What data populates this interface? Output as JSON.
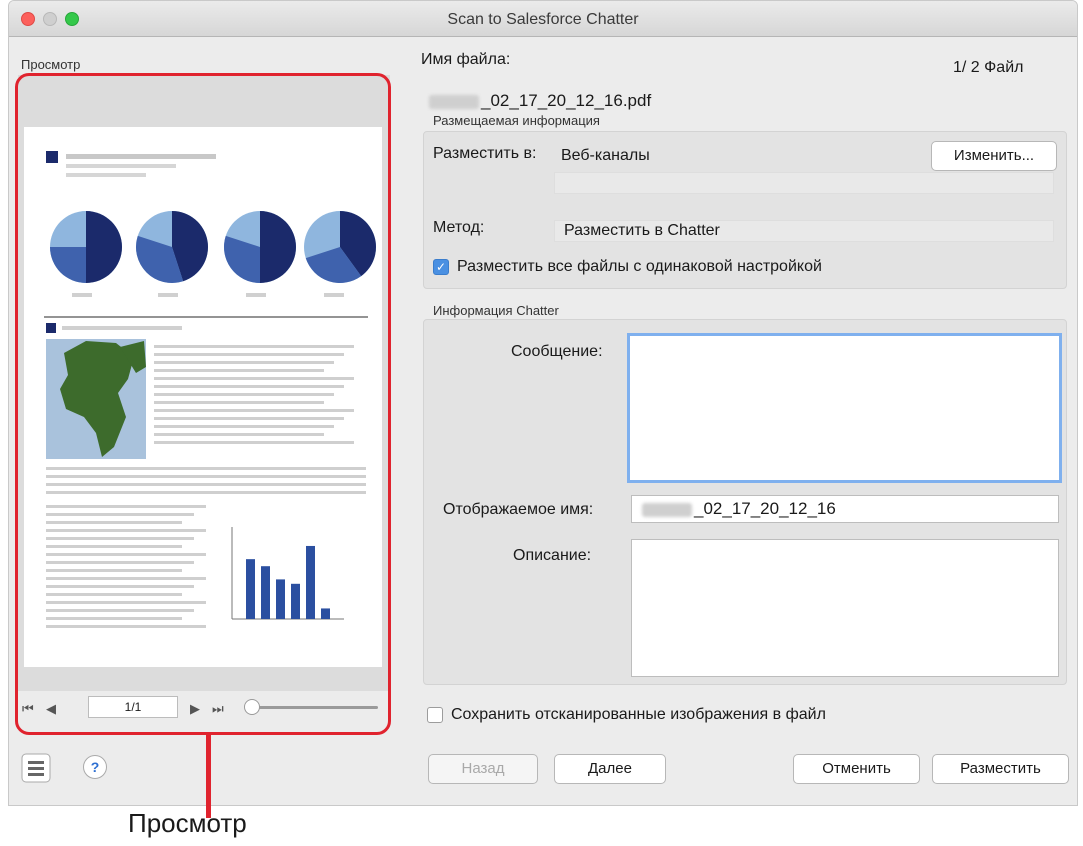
{
  "window": {
    "title": "Scan to Salesforce Chatter"
  },
  "preview": {
    "label": "Просмотр",
    "page_indicator": "1/1",
    "zoom_level": 0.0,
    "callout": "Просмотр"
  },
  "file": {
    "name_label": "Имя файла:",
    "count": "1/ 2 Файл",
    "filename": "_02_17_20_12_16.pdf"
  },
  "post_info": {
    "group_title": "Размещаемая информация",
    "post_to_label": "Разместить в:",
    "post_to_value": "Веб-каналы",
    "change_button": "Изменить...",
    "method_label": "Метод:",
    "method_value": "Разместить в Chatter",
    "same_settings_checkbox": {
      "label": "Разместить все файлы с одинаковой настройкой",
      "checked": true
    }
  },
  "chatter_info": {
    "group_title": "Информация Chatter",
    "message_label": "Сообщение:",
    "message_value": "",
    "display_name_label": "Отображаемое имя:",
    "display_name_value": "_02_17_20_12_16",
    "description_label": "Описание:",
    "description_value": ""
  },
  "save_images_checkbox": {
    "label": "Сохранить отсканированные изображения в файл",
    "checked": false
  },
  "buttons": {
    "back": "Назад",
    "next": "Далее",
    "cancel": "Отменить",
    "post": "Разместить"
  },
  "colors": {
    "highlight": "#e0232e",
    "pie_dark": "#1b2a6b",
    "pie_mid": "#3f62ad",
    "pie_light": "#8fb6de",
    "bar": "#2b4fa0",
    "map_land": "#3d6b2c",
    "map_sea": "#a9c2dc"
  }
}
